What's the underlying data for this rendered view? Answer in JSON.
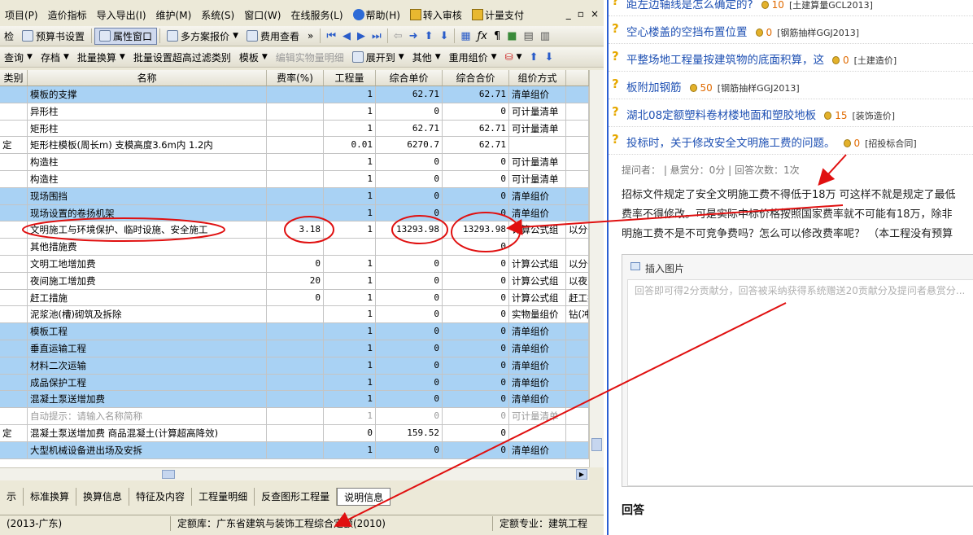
{
  "menu": {
    "items": [
      "项目(P)",
      "造价指标",
      "导入导出(I)",
      "维护(M)",
      "系统(S)",
      "窗口(W)",
      "在线服务(L)",
      "帮助(H)",
      "转入审核",
      "计量支付"
    ],
    "win_ctrl": [
      "_",
      "▫",
      "×"
    ]
  },
  "toolbar1": {
    "jian": "检",
    "budget_setting": "预算书设置",
    "property_window": "属性窗口",
    "multi_quote": "多方案报价",
    "fee_view": "费用查看"
  },
  "toolbar2": {
    "query": "查询",
    "save": "存档",
    "batch_convert": "批量换算",
    "batch_super": "批量设置超高过滤类别",
    "template": "模板",
    "edit_qty": "编辑实物量明细",
    "expand_to": "展开到",
    "other": "其他",
    "reuse_group": "重用组价"
  },
  "table": {
    "headers": [
      "类别",
      "名称",
      "费率(%)",
      "工程量",
      "综合单价",
      "综合合价",
      "组价方式",
      ""
    ],
    "rows": [
      {
        "style": "blue",
        "cat": "",
        "name": "模板的支撑",
        "rate": "",
        "qty": "1",
        "unit": "62.71",
        "total": "62.71",
        "method": "清单组价",
        "extra": ""
      },
      {
        "style": "white",
        "cat": "",
        "name": "异形柱",
        "rate": "",
        "qty": "1",
        "unit": "0",
        "total": "0",
        "method": "可计量清单",
        "extra": ""
      },
      {
        "style": "white",
        "cat": "",
        "name": "矩形柱",
        "rate": "",
        "qty": "1",
        "unit": "62.71",
        "total": "62.71",
        "method": "可计量清单",
        "extra": ""
      },
      {
        "style": "white",
        "cat": "定",
        "name": "矩形柱模板(周长m) 支模高度3.6m内 1.2内",
        "rate": "",
        "qty": "0.01",
        "unit": "6270.7",
        "total": "62.71",
        "method": "",
        "extra": ""
      },
      {
        "style": "white",
        "cat": "",
        "name": "构造柱",
        "rate": "",
        "qty": "1",
        "unit": "0",
        "total": "0",
        "method": "可计量清单",
        "extra": ""
      },
      {
        "style": "white",
        "cat": "",
        "name": "构造柱",
        "rate": "",
        "qty": "1",
        "unit": "0",
        "total": "0",
        "method": "可计量清单",
        "extra": ""
      },
      {
        "style": "blue",
        "cat": "",
        "name": "现场围挡",
        "rate": "",
        "qty": "1",
        "unit": "0",
        "total": "0",
        "method": "清单组价",
        "extra": ""
      },
      {
        "style": "blue",
        "cat": "",
        "name": "现场设置的卷扬机架",
        "rate": "",
        "qty": "1",
        "unit": "0",
        "total": "0",
        "method": "清单组价",
        "extra": ""
      },
      {
        "style": "white",
        "cat": "",
        "name": "文明施工与环境保护、临时设施、安全施工",
        "rate": "3.18",
        "qty": "1",
        "unit": "13293.98",
        "total": "13293.98",
        "method": "计算公式组",
        "extra": "以分部"
      },
      {
        "style": "white",
        "cat": "",
        "name": "其他措施费",
        "rate": "",
        "qty": "",
        "unit": "",
        "total": "0",
        "method": "",
        "extra": ""
      },
      {
        "style": "white",
        "cat": "",
        "name": "文明工地增加费",
        "rate": "0",
        "qty": "1",
        "unit": "0",
        "total": "0",
        "method": "计算公式组",
        "extra": "以分部"
      },
      {
        "style": "white",
        "cat": "",
        "name": "夜间施工增加费",
        "rate": "20",
        "qty": "1",
        "unit": "0",
        "total": "0",
        "method": "计算公式组",
        "extra": "以夜间"
      },
      {
        "style": "white",
        "cat": "",
        "name": "赶工措施",
        "rate": "0",
        "qty": "1",
        "unit": "0",
        "total": "0",
        "method": "计算公式组",
        "extra": "赶工措"
      },
      {
        "style": "white",
        "cat": "",
        "name": "泥浆池(槽)砌筑及拆除",
        "rate": "",
        "qty": "1",
        "unit": "0",
        "total": "0",
        "method": "实物量组价",
        "extra": "钻(冲)"
      },
      {
        "style": "blue",
        "cat": "",
        "name": "模板工程",
        "rate": "",
        "qty": "1",
        "unit": "0",
        "total": "0",
        "method": "清单组价",
        "extra": ""
      },
      {
        "style": "blue",
        "cat": "",
        "name": "垂直运输工程",
        "rate": "",
        "qty": "1",
        "unit": "0",
        "total": "0",
        "method": "清单组价",
        "extra": ""
      },
      {
        "style": "blue",
        "cat": "",
        "name": "材料二次运输",
        "rate": "",
        "qty": "1",
        "unit": "0",
        "total": "0",
        "method": "清单组价",
        "extra": ""
      },
      {
        "style": "blue",
        "cat": "",
        "name": "成品保护工程",
        "rate": "",
        "qty": "1",
        "unit": "0",
        "total": "0",
        "method": "清单组价",
        "extra": ""
      },
      {
        "style": "blue",
        "cat": "",
        "name": "混凝土泵送增加费",
        "rate": "",
        "qty": "1",
        "unit": "0",
        "total": "0",
        "method": "清单组价",
        "extra": ""
      },
      {
        "style": "hint",
        "cat": "",
        "name": "自动提示：请输入名称简称",
        "rate": "",
        "qty": "1",
        "unit": "0",
        "total": "0",
        "method": "可计量清单",
        "extra": ""
      },
      {
        "style": "white",
        "cat": "定",
        "name": "混凝土泵送增加费 商品混凝土(计算超高降效)",
        "rate": "",
        "qty": "0",
        "unit": "159.52",
        "total": "0",
        "method": "",
        "extra": ""
      },
      {
        "style": "blue",
        "cat": "",
        "name": "大型机械设备进出场及安拆",
        "rate": "",
        "qty": "1",
        "unit": "0",
        "total": "0",
        "method": "清单组价",
        "extra": ""
      }
    ]
  },
  "tabs": [
    "示",
    "标准换算",
    "换算信息",
    "特征及内容",
    "工程量明细",
    "反查图形工程量",
    "说明信息"
  ],
  "status": {
    "left": "(2013-广东)",
    "quota_lib": "定额库：广东省建筑与装饰工程综合定额(2010)",
    "quota_major": "定额专业：建筑工程"
  },
  "web": {
    "questions": [
      {
        "title": "距左边轴线是怎么确定的?",
        "score": "10",
        "tag": "[土建算量GCL2013]"
      },
      {
        "title": "空心楼盖的空挡布置位置",
        "score": "0",
        "tag": "[钢筋抽样GGJ2013]"
      },
      {
        "title": "平整场地工程量按建筑物的底面积算，这",
        "score": "0",
        "tag": "[土建造价]"
      },
      {
        "title": "板附加钢筋",
        "score": "50",
        "tag": "[钢筋抽样GGJ2013]"
      },
      {
        "title": "湖北08定额塑料卷材楼地面和塑胶地板",
        "score": "15",
        "tag": "[装饰造价]"
      },
      {
        "title": "投标时，关于修改安全文明施工费的问题。",
        "score": "0",
        "tag": "[招投标合同]"
      }
    ],
    "meta": "提问者：  |  悬赏分：0分  |  回答次数：1次",
    "desc1": "招标文件规定了安全文明施工费不得低于18万 可这样不就是规定了最低",
    "desc2": "费率不得修改。可是实际中标价格按照国家费率就不可能有18万，除非",
    "desc3": "明施工费不是不可竞争费吗？怎么可以修改费率呢？ （本工程没有预算",
    "insert_picture": "插入图片",
    "answer_placeholder": "回答即可得2分贡献分，回答被采纳获得系统赠送20贡献分及提问者悬赏分...",
    "answer_heading": "回答"
  },
  "colors": {
    "blue_row": "#a9d2f4",
    "annotation_red": "#e01010",
    "link_blue": "#1e50b3"
  }
}
